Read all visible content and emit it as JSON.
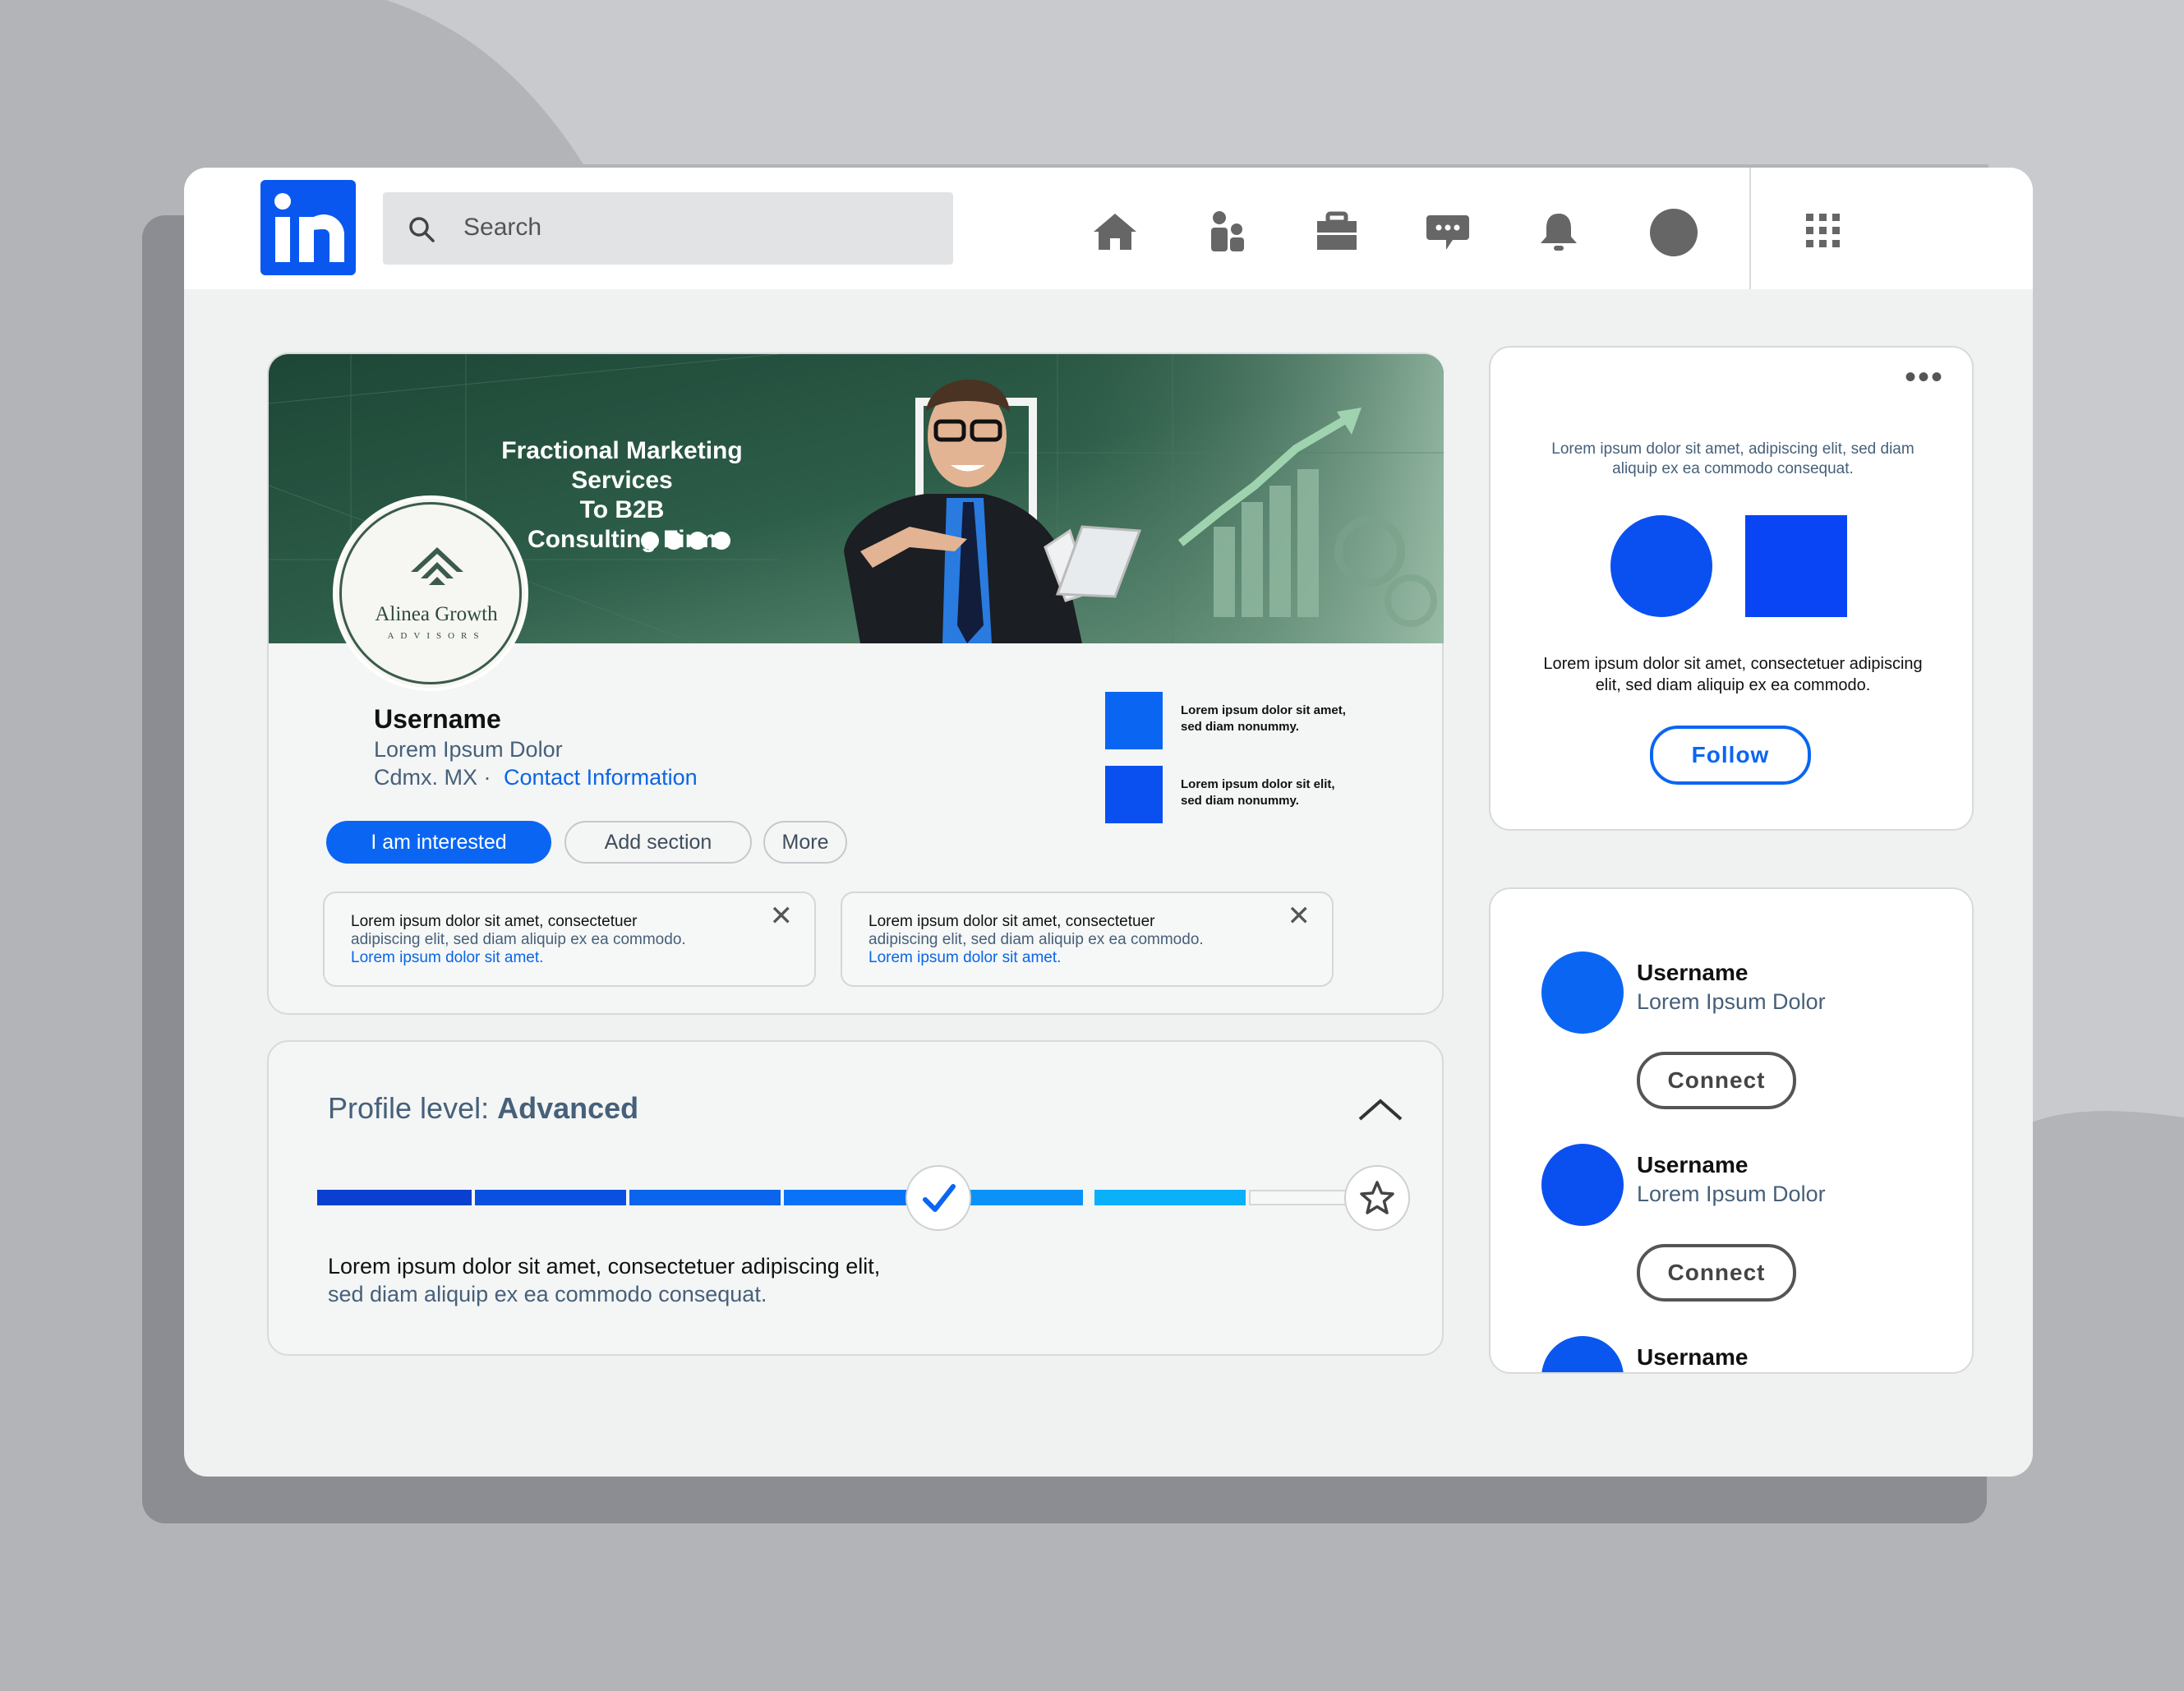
{
  "search": {
    "placeholder": "Search"
  },
  "nav": {
    "items": [
      "home-icon",
      "my-network-icon",
      "jobs-icon",
      "messaging-icon",
      "notifications-icon",
      "profile-avatar",
      "apps-grid-icon"
    ]
  },
  "colors": {
    "brand": "#0a57f0",
    "primary": "#0a66f2",
    "banner_green": "#2e5b48"
  },
  "profile": {
    "banner": {
      "title_lines": [
        "Fractional Marketing Services",
        "To B2B",
        "Consulting Firm"
      ],
      "social_icons": [
        "facebook-icon",
        "instagram-icon",
        "linkedin-icon",
        "twitter-icon"
      ]
    },
    "avatar": {
      "brand_name": "Alinea Growth",
      "brand_sub": "ADVISORS"
    },
    "username": "Username",
    "headline": "Lorem Ipsum Dolor",
    "location": "Cdmx. MX ·",
    "contact_link": "Contact Information",
    "buttons": {
      "primary": "I am interested",
      "add_section": "Add section",
      "more": "More"
    },
    "highlights": [
      {
        "line1": "Lorem ipsum dolor sit amet,",
        "line2": "sed diam nonummy."
      },
      {
        "line1": "Lorem ipsum dolor sit elit,",
        "line2": "sed diam nonummy."
      }
    ],
    "notices": [
      {
        "line1": "Lorem ipsum dolor sit amet, consectetuer",
        "line2": "adipiscing elit, sed diam aliquip ex ea commodo.",
        "link": "Lorem ipsum dolor sit amet."
      },
      {
        "line1": "Lorem ipsum dolor sit amet, consectetuer",
        "line2": "adipiscing elit, sed diam aliquip ex ea commodo.",
        "link": "Lorem ipsum dolor sit amet."
      }
    ]
  },
  "profile_level": {
    "label": "Profile level:",
    "value": "Advanced",
    "progress_colors": [
      "#0a3fd0",
      "#0a50e0",
      "#0a64ec",
      "#0a72f6",
      "#0a92f8",
      "#0ab0fa",
      "#f7f7f7"
    ],
    "completed_steps": 4,
    "total_steps": 7,
    "desc_line1": "Lorem ipsum dolor sit amet, consectetuer adipiscing elit,",
    "desc_line2": "sed diam aliquip ex ea commodo consequat."
  },
  "promo_card": {
    "text_top": "Lorem ipsum dolor sit amet, adipiscing elit, sed diam aliquip ex ea commodo consequat.",
    "text_bottom": "Lorem ipsum dolor sit amet, consectetuer adipiscing elit, sed diam aliquip ex ea commodo.",
    "follow": "Follow"
  },
  "suggestions": [
    {
      "name": "Username",
      "headline": "Lorem Ipsum Dolor",
      "action": "Connect",
      "color": "#0a66f2"
    },
    {
      "name": "Username",
      "headline": "Lorem Ipsum Dolor",
      "action": "Connect",
      "color": "#0a50f0"
    },
    {
      "name": "Username",
      "headline": "",
      "action": "",
      "color": "#0a57f0"
    }
  ]
}
